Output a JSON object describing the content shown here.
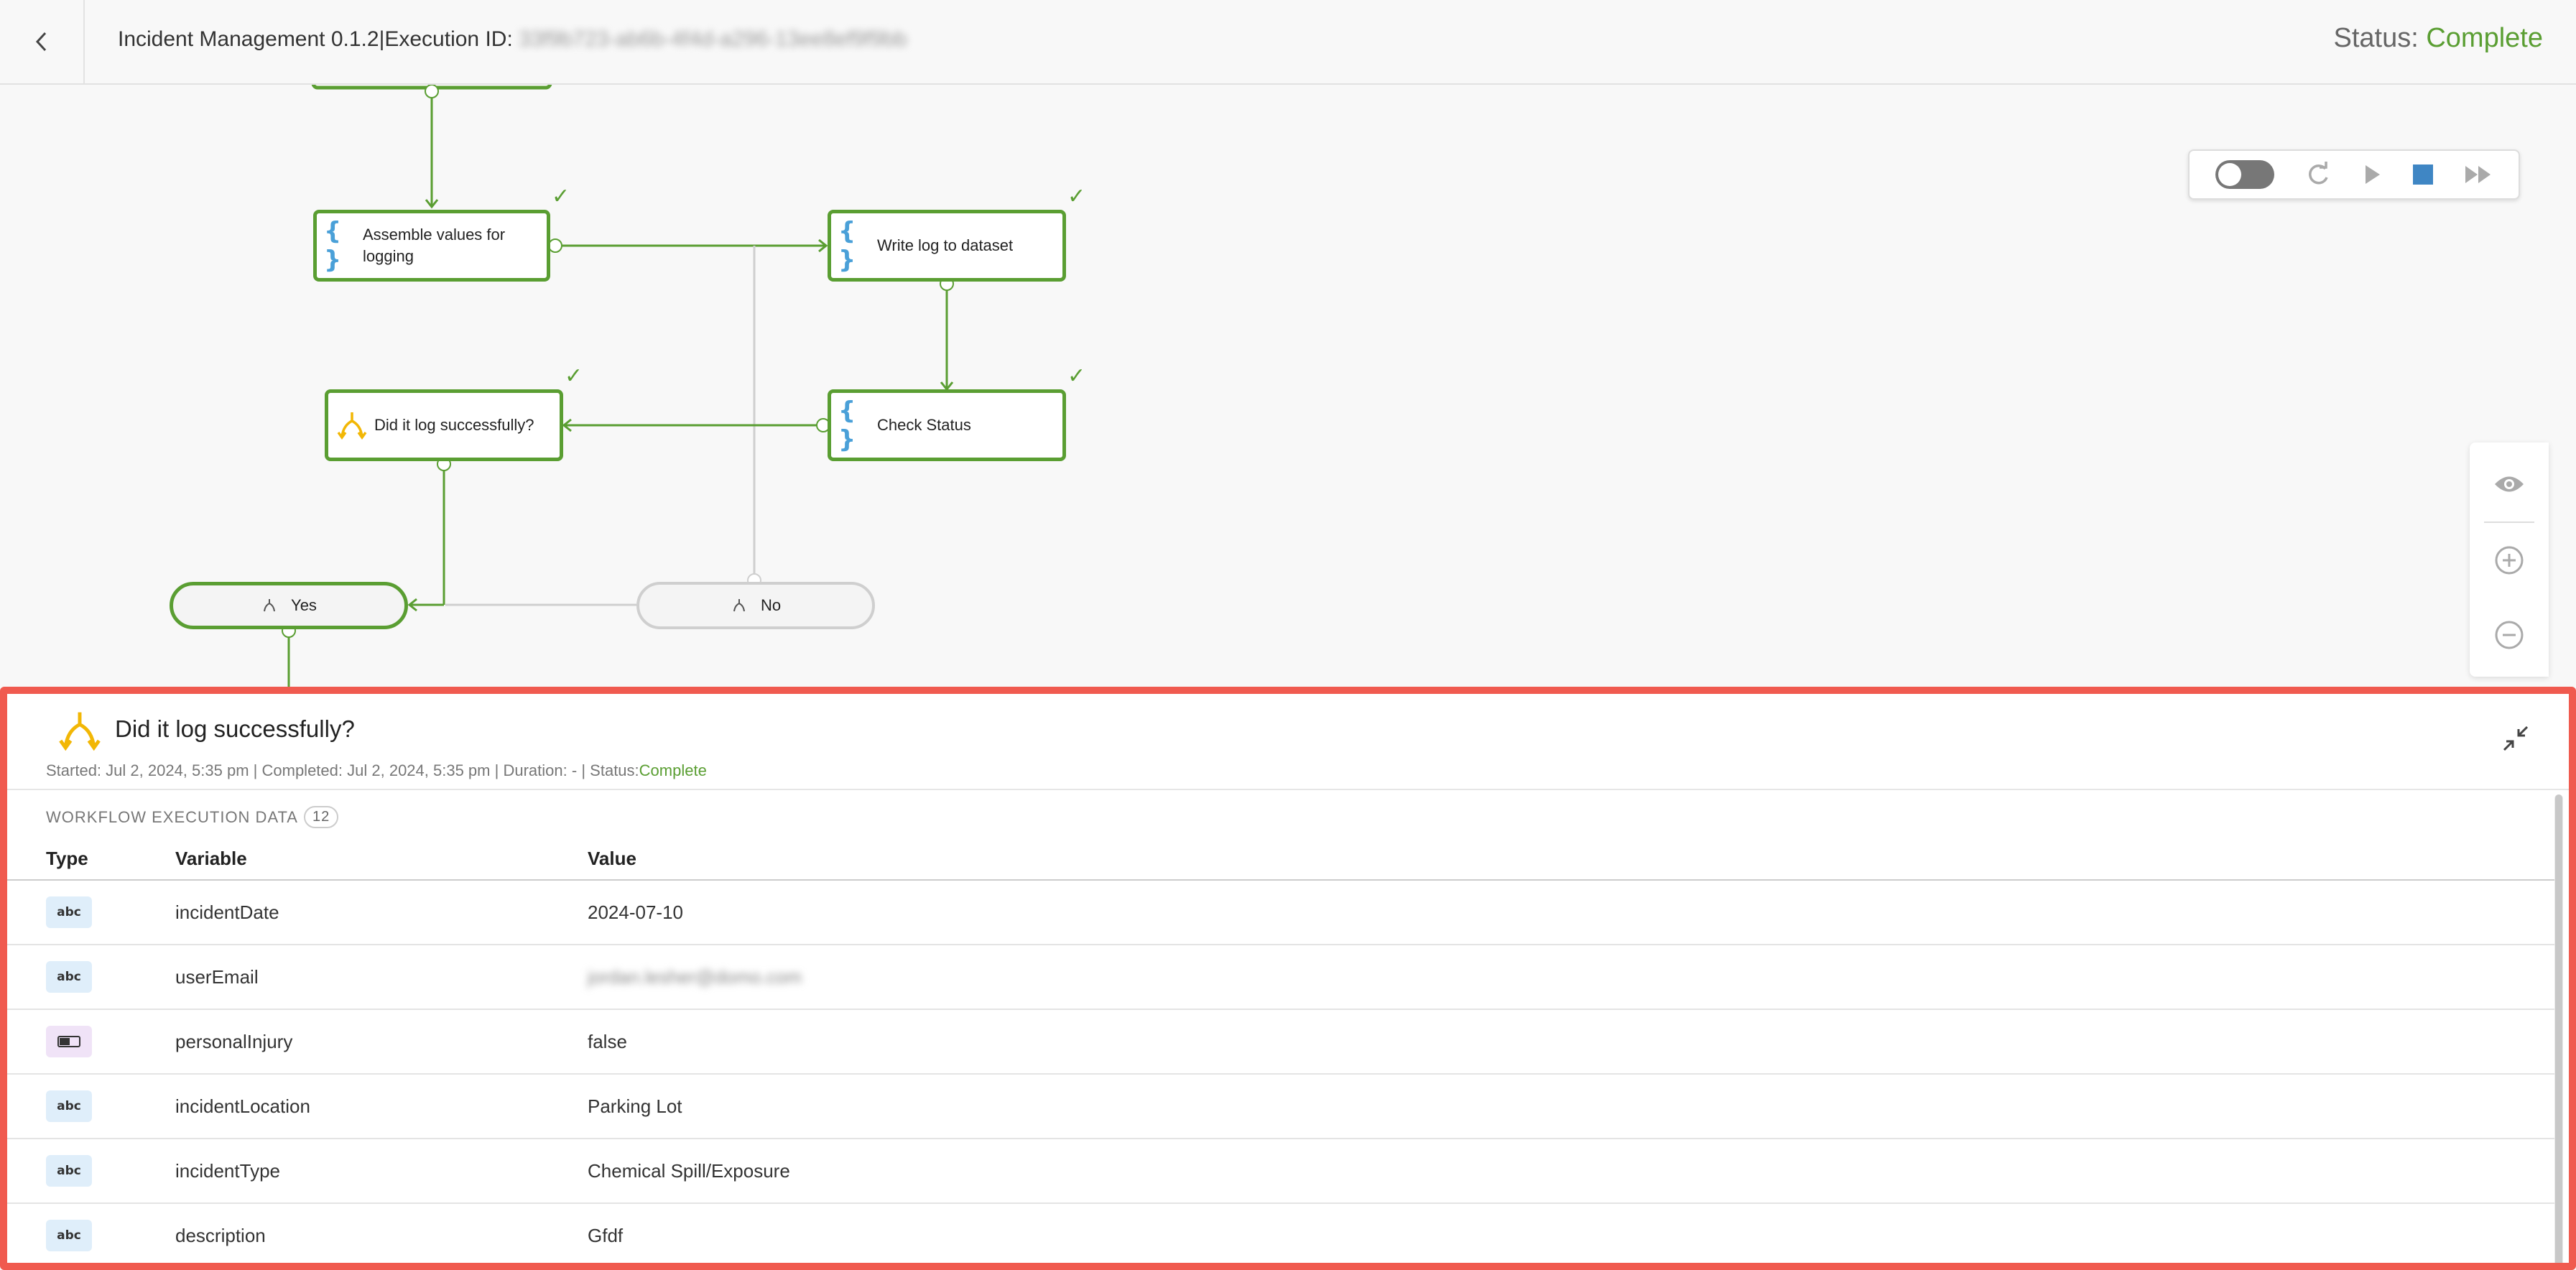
{
  "header": {
    "title": "Incident Management 0.1.2|Execution ID:",
    "execution_id": "33f9b723-ab6b-4f4d-a296-13ee8ef9f9bb",
    "status_label": "Status:",
    "status_value": "Complete",
    "back_icon": "chevron-left-icon"
  },
  "colors": {
    "accent_green": "#5a9e32",
    "highlight_red": "#f05a4f",
    "function_blue": "#4aa0d8",
    "decision_yellow": "#f2b705"
  },
  "workflow": {
    "nodes": [
      {
        "label": "Assemble values for logging",
        "kind": "function",
        "status": "complete"
      },
      {
        "label": "Write log to dataset",
        "kind": "function",
        "status": "complete"
      },
      {
        "label": "Did it log successfully?",
        "kind": "decision",
        "status": "complete"
      },
      {
        "label": "Check Status",
        "kind": "function",
        "status": "complete"
      }
    ],
    "branches": [
      {
        "label": "Yes",
        "active": true
      },
      {
        "label": "No",
        "active": false
      }
    ]
  },
  "toolbar": {
    "items": [
      "toggle",
      "refresh-icon",
      "play-icon",
      "stop-icon",
      "fast-forward-icon"
    ]
  },
  "zoom": {
    "items": [
      "eye-icon",
      "zoom-in-icon",
      "zoom-out-icon"
    ]
  },
  "detail": {
    "title": "Did it log successfully?",
    "meta": {
      "started_label": "Started:",
      "started": "Jul 2, 2024, 5:35 pm",
      "completed_label": "Completed:",
      "completed": "Jul 2, 2024, 5:35 pm",
      "duration_label": "Duration:",
      "duration": "-",
      "status_label": "Status:",
      "status": "Complete",
      "sep": "|"
    },
    "section_label": "WORKFLOW EXECUTION DATA",
    "count": "12",
    "columns": [
      "Type",
      "Variable",
      "Value"
    ],
    "rows": [
      {
        "type": "abc",
        "type_kind": "string",
        "variable": "incidentDate",
        "value": "2024-07-10"
      },
      {
        "type": "abc",
        "type_kind": "string",
        "variable": "userEmail",
        "value": "jordan.lesher@domo.com"
      },
      {
        "type": "",
        "type_kind": "boolean",
        "variable": "personalInjury",
        "value": "false"
      },
      {
        "type": "abc",
        "type_kind": "string",
        "variable": "incidentLocation",
        "value": "Parking Lot"
      },
      {
        "type": "abc",
        "type_kind": "string",
        "variable": "incidentType",
        "value": "Chemical Spill/Exposure"
      },
      {
        "type": "abc",
        "type_kind": "string",
        "variable": "description",
        "value": "Gfdf"
      }
    ]
  }
}
